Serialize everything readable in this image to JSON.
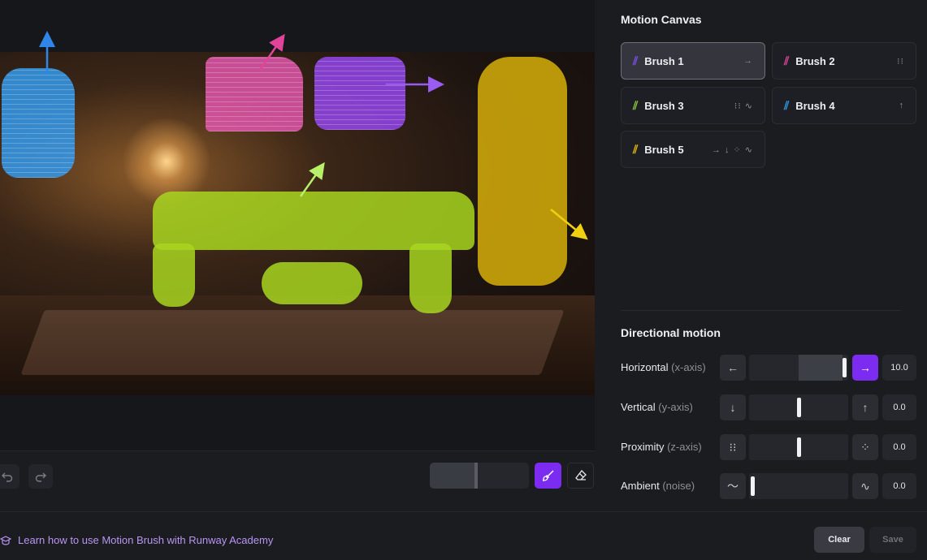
{
  "motion_canvas": {
    "title": "Motion Canvas",
    "brushes": [
      {
        "label": "Brush 1",
        "color": "#7b4ff0",
        "icons": "→",
        "selected": true
      },
      {
        "label": "Brush 2",
        "color": "#e0449a",
        "icons": "⁝⁝",
        "selected": false
      },
      {
        "label": "Brush 3",
        "color": "#8cc63f",
        "icons": "⁝⁝ ∿",
        "selected": false
      },
      {
        "label": "Brush 4",
        "color": "#2f9ae8",
        "icons": "↑",
        "selected": false
      },
      {
        "label": "Brush 5",
        "color": "#e5b80b",
        "icons": "→ ↓ ⁘ ∿",
        "selected": false
      }
    ]
  },
  "directional_motion": {
    "title": "Directional motion",
    "rows": [
      {
        "label": "Horizontal",
        "axis": "(x-axis)",
        "left_icon": "←",
        "right_icon": "→",
        "value": "10.0",
        "level": 1.0
      },
      {
        "label": "Vertical",
        "axis": "(y-axis)",
        "left_icon": "↓",
        "right_icon": "↑",
        "value": "0.0",
        "level": 0.5
      },
      {
        "label": "Proximity",
        "axis": "(z-axis)",
        "left_icon": "⁝⁝",
        "right_icon": "⁘",
        "value": "0.0",
        "level": 0.5
      },
      {
        "label": "Ambient",
        "axis": "(noise)",
        "left_icon": "〜",
        "right_icon": "∿",
        "value": "0.0",
        "level": 0.0
      }
    ]
  },
  "footer": {
    "academy_link": "Learn how to use Motion Brush with Runway Academy",
    "clear": "Clear",
    "save": "Save"
  },
  "toolbar": {
    "brush_size_level": 0.47
  },
  "colors": {
    "accent": "#7b2cf0",
    "link": "#b995f3"
  }
}
